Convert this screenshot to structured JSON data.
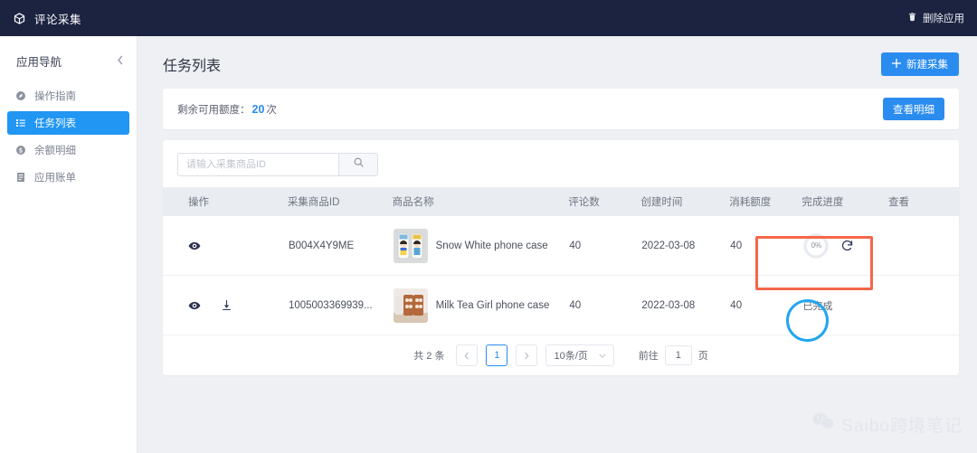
{
  "topbar": {
    "logo_icon": "cube-icon",
    "app_title": "评论采集",
    "delete_icon": "trash-icon",
    "delete_label": "删除应用"
  },
  "sidebar": {
    "title": "应用导航",
    "collapse_icon": "chevron-left-icon",
    "items": [
      {
        "label": "操作指南",
        "icon": "compass-icon",
        "active": false
      },
      {
        "label": "任务列表",
        "icon": "list-icon",
        "active": true
      },
      {
        "label": "余额明细",
        "icon": "coin-icon",
        "active": false
      },
      {
        "label": "应用账单",
        "icon": "document-icon",
        "active": false
      }
    ]
  },
  "page": {
    "title": "任务列表",
    "new_task_icon": "plus-icon",
    "new_task_label": "新建采集"
  },
  "quota": {
    "label": "剩余可用额度：",
    "value": "20",
    "unit": "次",
    "detail_button": "查看明细"
  },
  "search": {
    "placeholder": "请输入采集商品ID",
    "value": "",
    "icon": "search-icon"
  },
  "table": {
    "columns": [
      "操作",
      "采集商品ID",
      "商品名称",
      "评论数",
      "创建时间",
      "消耗额度",
      "完成进度",
      "查看"
    ],
    "rows": [
      {
        "ops": [
          "eye-icon"
        ],
        "product_id": "B004X4Y9ME",
        "product_name": "Snow White phone case",
        "thumb": "snow-white-phone-case-thumbnail",
        "review_count": "40",
        "create_time": "2022-03-08",
        "used_quota": "40",
        "progress_type": "ring",
        "progress_text": "0%",
        "refresh_icon": "refresh-icon",
        "view": ""
      },
      {
        "ops": [
          "eye-icon",
          "download-icon"
        ],
        "product_id": "1005003369939...",
        "product_name": "Milk Tea Girl phone case",
        "thumb": "milk-tea-girl-phone-case-thumbnail",
        "review_count": "40",
        "create_time": "2022-03-08",
        "used_quota": "40",
        "progress_type": "done",
        "progress_text": "已完成",
        "refresh_icon": "",
        "view": ""
      }
    ]
  },
  "pagination": {
    "total_text": "共 2 条",
    "prev_icon": "chevron-left-icon",
    "current_page": "1",
    "next_icon": "chevron-right-icon",
    "page_size": "10条/页",
    "size_caret_icon": "chevron-down-icon",
    "jump_label": "前往",
    "jump_value": "1",
    "jump_unit": "页"
  },
  "annotations": {
    "red_rect_target": "progress-cell-row-1",
    "blue_circle_target": "done-badge-row-2",
    "red_color": "#f4664a",
    "blue_color": "#22a5f0"
  },
  "watermark": {
    "icon": "wechat-icon",
    "text": "Saibo跨境笔记"
  },
  "colors": {
    "topbar_bg": "#1c2340",
    "accent_blue": "#2b8cf0",
    "sidebar_active": "#2196f3",
    "page_bg": "#eef0f4"
  }
}
